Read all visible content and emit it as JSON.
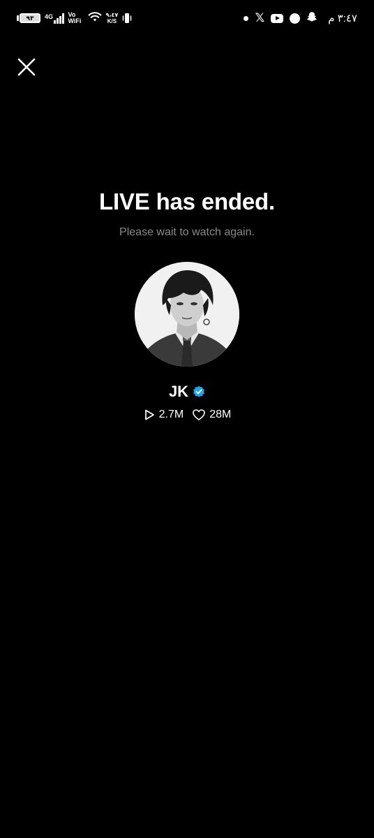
{
  "status_bar": {
    "battery_level": "٩٣",
    "network": "4G",
    "vowifi_line1": "Vo",
    "vowifi_line2": "WiFi",
    "speed_value": "٩،٤٧",
    "speed_unit": "K/S",
    "time": "٣:٤٧ م",
    "icons": [
      "dot-icon",
      "x-icon",
      "youtube-icon",
      "circle-app-icon",
      "snapchat-icon"
    ]
  },
  "close": {
    "icon": "close-icon"
  },
  "main": {
    "title": "LIVE has ended.",
    "subtitle": "Please wait to watch again."
  },
  "profile": {
    "name": "JK",
    "verified": true,
    "verified_color": "#20a6e8",
    "views": "2.7M",
    "likes": "28M"
  }
}
